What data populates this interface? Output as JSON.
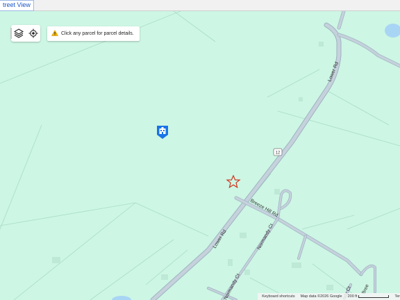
{
  "tab": {
    "label": "treet View"
  },
  "toolbar": {
    "layers_icon": "layers-icon",
    "locate_icon": "locate-icon"
  },
  "notice": {
    "icon": "warning-icon",
    "text": "Click any parcel for parcel details."
  },
  "roads": {
    "lower_rd_upper": "Lower Rd",
    "lower_rd_lower": "Lower Rd",
    "route_shield": "12",
    "breeze_hill_rd": "Breeze Hill Rd",
    "normandy_ct_1": "Normandy Ct",
    "normandy_ct_2": "Normandy Ct",
    "normandy_ct_3": "ndy Ct",
    "breeze_fragment": "Bree"
  },
  "markers": {
    "school_icon": "school-pin-icon",
    "star_icon": "selected-location-star-icon"
  },
  "footer": {
    "shortcuts": "Keyboard shortcuts",
    "map_data": "Map data ©2026 Google",
    "scale": "200 ft",
    "terms": "Ter"
  },
  "colors": {
    "map_background": "#cdf6e4",
    "road": "#b9c8d3",
    "road_edge": "#9fb2c1",
    "water": "#a9d5f5",
    "parcel_line": "#a8dcc6",
    "star": "#d0331e",
    "pin": "#1a73e8"
  }
}
